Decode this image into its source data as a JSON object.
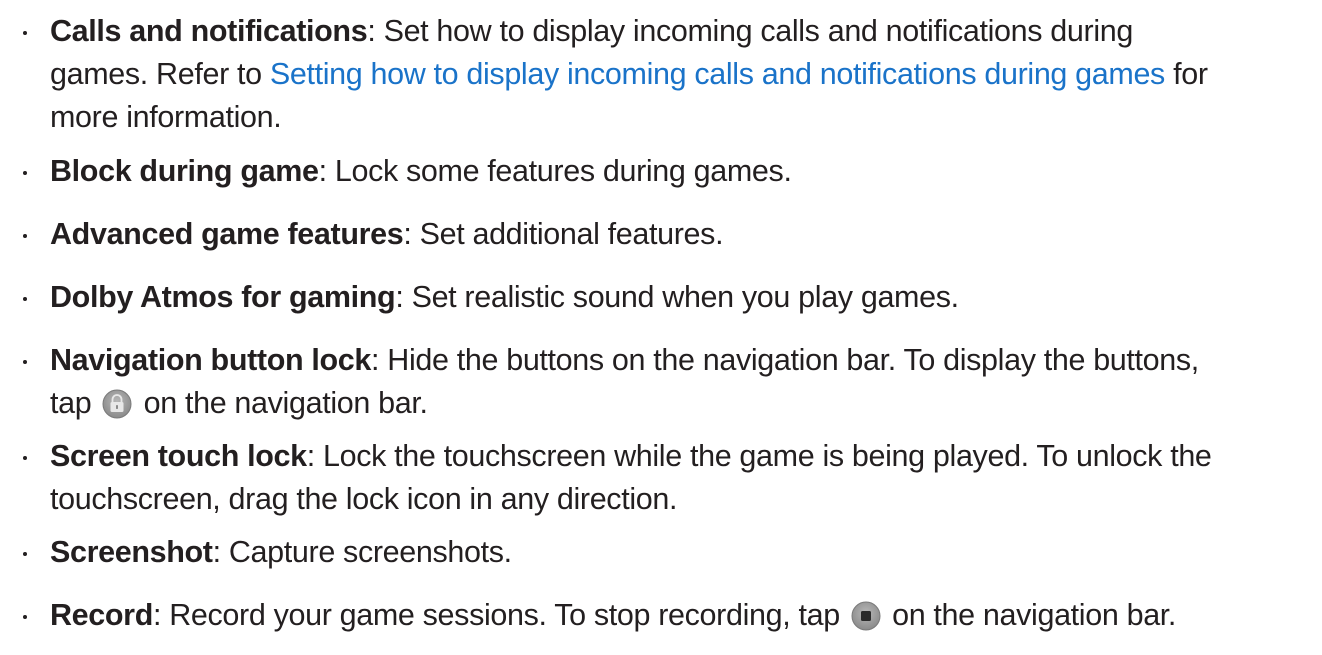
{
  "items": [
    {
      "term": "Calls and notifications",
      "line1": ": Set how to display incoming calls and notifications during",
      "line2_pre": "games. Refer to ",
      "line2_link": "Setting how to display incoming calls and notifications during games",
      "line2_post": " for",
      "line3": "more information."
    },
    {
      "term": "Block during game",
      "line1": ": Lock some features during games."
    },
    {
      "term": "Advanced game features",
      "line1": ": Set additional features."
    },
    {
      "term": "Dolby Atmos for gaming",
      "line1": ": Set realistic sound when you play games."
    },
    {
      "term": "Navigation button lock",
      "line1": ": Hide the buttons on the navigation bar. To display the buttons,",
      "line2_pre": "tap",
      "line2_icon": "lock-icon",
      "line2_post": "on the navigation bar."
    },
    {
      "term": "Screen touch lock",
      "line1": ": Lock the touchscreen while the game is being played. To unlock the",
      "line2": "touchscreen, drag the lock icon in any direction."
    },
    {
      "term": "Screenshot",
      "line1": ": Capture screenshots."
    },
    {
      "term": "Record",
      "line1": ": Record your game sessions. To stop recording, tap",
      "line1_icon": "stop-icon",
      "line1_post": "on the navigation bar."
    }
  ],
  "colors": {
    "text": "#231f20",
    "link": "#1a73c9",
    "icon_bg": "#9a9a9a"
  }
}
